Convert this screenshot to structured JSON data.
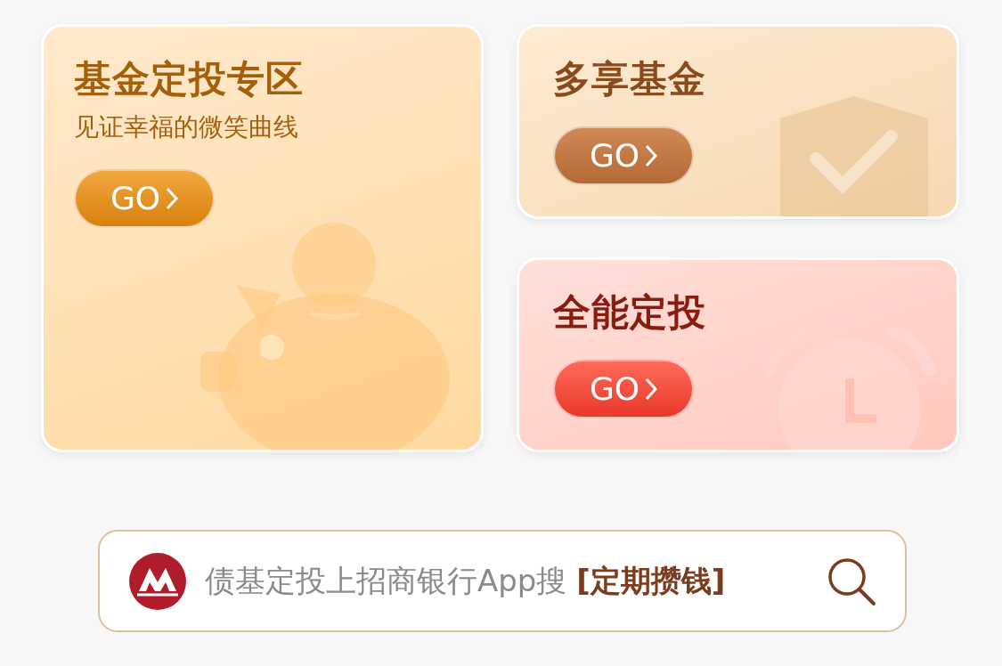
{
  "cards": [
    {
      "kind": "piggy",
      "color": "#a35f0a",
      "title": "基金定投专区",
      "subtitle": "见证幸福的微笑曲线",
      "button": "GO"
    },
    {
      "kind": "shield",
      "color": "#8a4a1c",
      "title": "多享基金",
      "button": "GO"
    },
    {
      "kind": "clock",
      "color": "#8b1a0f",
      "title": "全能定投",
      "button": "GO"
    }
  ],
  "search": {
    "text": "债基定投上招商银行App搜 **[定期攒钱]**"
  }
}
